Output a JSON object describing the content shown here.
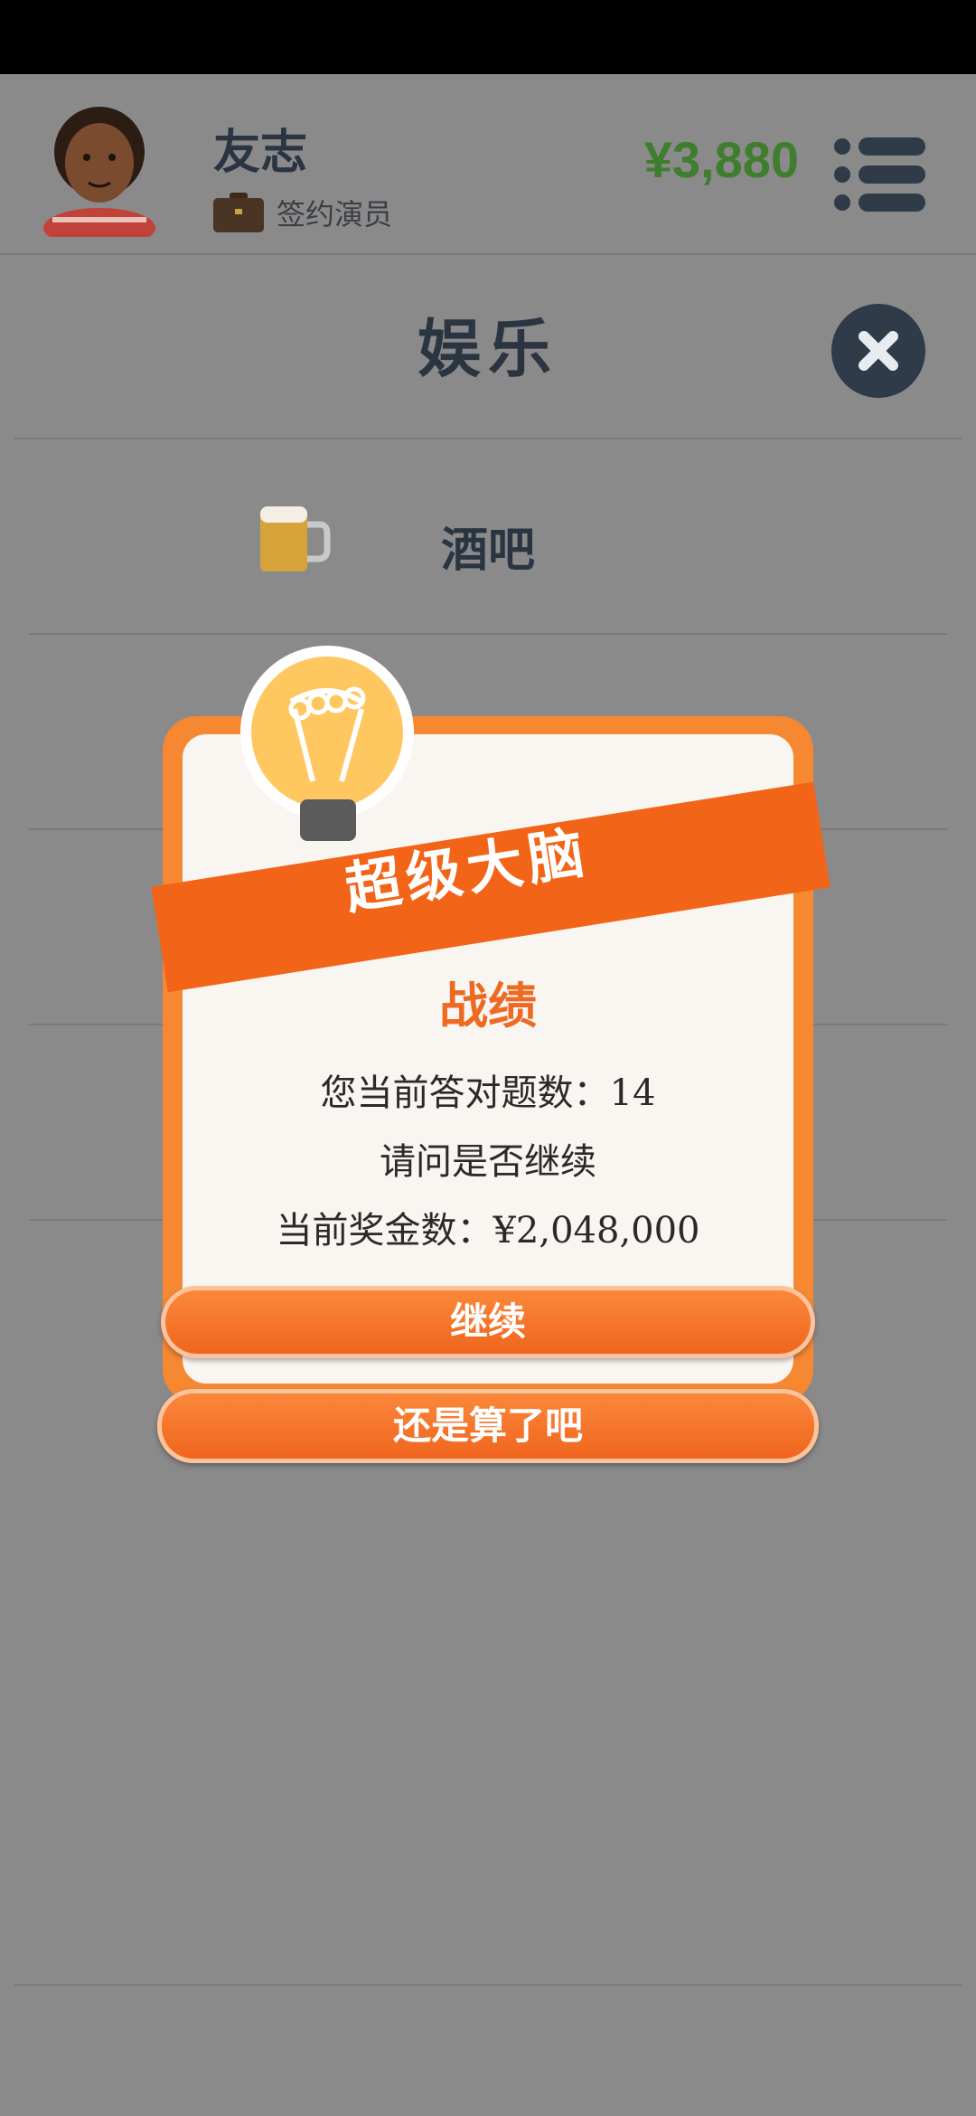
{
  "header": {
    "player_name": "友志",
    "role": "签约演员",
    "money": "¥3,880"
  },
  "page": {
    "title": "娱乐",
    "items": [
      {
        "label": "酒吧",
        "icon": "beer-mug-icon"
      }
    ]
  },
  "modal": {
    "banner": "超级大脑",
    "heading": "战绩",
    "line1": "您当前答对题数：14",
    "line2": "请问是否继续",
    "line3": "当前奖金数：¥2,048,000",
    "continue_label": "继续",
    "quit_label": "还是算了吧"
  },
  "colors": {
    "overlay": "#8a8a8a",
    "accent": "#f26418",
    "money": "#3f7d2f"
  }
}
